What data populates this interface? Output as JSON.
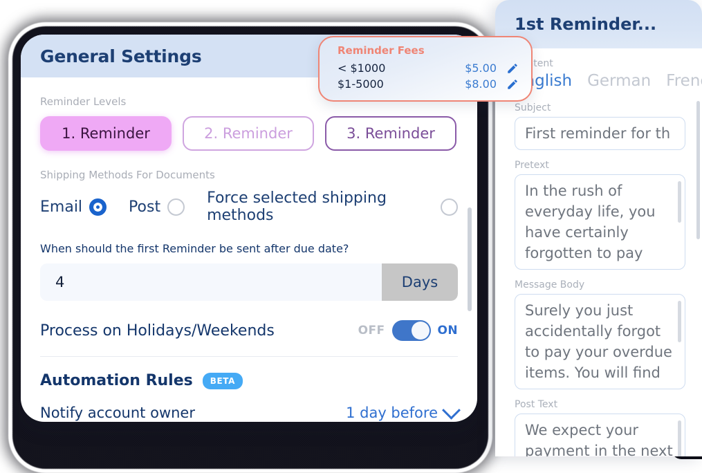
{
  "left_panel": {
    "header_title": "General Settings",
    "reminder_levels": {
      "label": "Reminder Levels",
      "items": [
        {
          "label": "1. Reminder",
          "state": "active"
        },
        {
          "label": "2. Reminder",
          "state": "inactive-light"
        },
        {
          "label": "3. Reminder",
          "state": "inactive-dark"
        }
      ]
    },
    "shipping": {
      "label": "Shipping Methods For Documents",
      "options": [
        {
          "label": "Email",
          "selected": true
        },
        {
          "label": "Post",
          "selected": false
        },
        {
          "label": "Force selected shipping methods",
          "selected": false
        }
      ]
    },
    "first_reminder": {
      "question": "When should the first Reminder be sent after due date?",
      "value": "4",
      "unit": "Days"
    },
    "holidays_toggle": {
      "label": "Process on Holidays/Weekends",
      "off_label": "OFF",
      "on_label": "ON",
      "state": "ON"
    },
    "automation": {
      "heading": "Automation Rules",
      "badge": "BETA",
      "rules": [
        {
          "label": "Notify account owner",
          "value": "1 day before"
        }
      ]
    }
  },
  "fees_popup": {
    "title": "Reminder Fees",
    "rows": [
      {
        "range": "< $1000",
        "amount": "$5.00",
        "action_icon": "pencil-icon"
      },
      {
        "range": "$1-5000",
        "amount": "$8.00",
        "action_icon": "pencil-icon"
      }
    ],
    "border_color": "#ef8575",
    "title_color": "#ef8575",
    "amount_color": "#3a7bd0"
  },
  "right_panel": {
    "header_title": "1st Reminder...",
    "content_label": "Content",
    "languages": [
      {
        "label": "English",
        "active": true
      },
      {
        "label": "German",
        "active": false
      },
      {
        "label": "French",
        "active": false
      }
    ],
    "fields": [
      {
        "label": "Subject",
        "value": "First reminder for th",
        "type": "input"
      },
      {
        "label": "Pretext",
        "value": "In the rush of everyday life, you have certainly forgotten to pay",
        "type": "textarea"
      },
      {
        "label": "Message Body",
        "value": "Surely you just accidentally forgot to pay your overdue items. You will find",
        "type": "textarea"
      },
      {
        "label": "Post Text",
        "value": "We expect your payment in the next",
        "type": "textarea"
      }
    ]
  },
  "colors": {
    "header_blue": "#d4e1f4",
    "navy_text": "#14366b",
    "accent_blue": "#2f6fd0",
    "active_pill": "#efa9f5",
    "beta_badge": "#45aaf5",
    "coral": "#ef8575"
  }
}
